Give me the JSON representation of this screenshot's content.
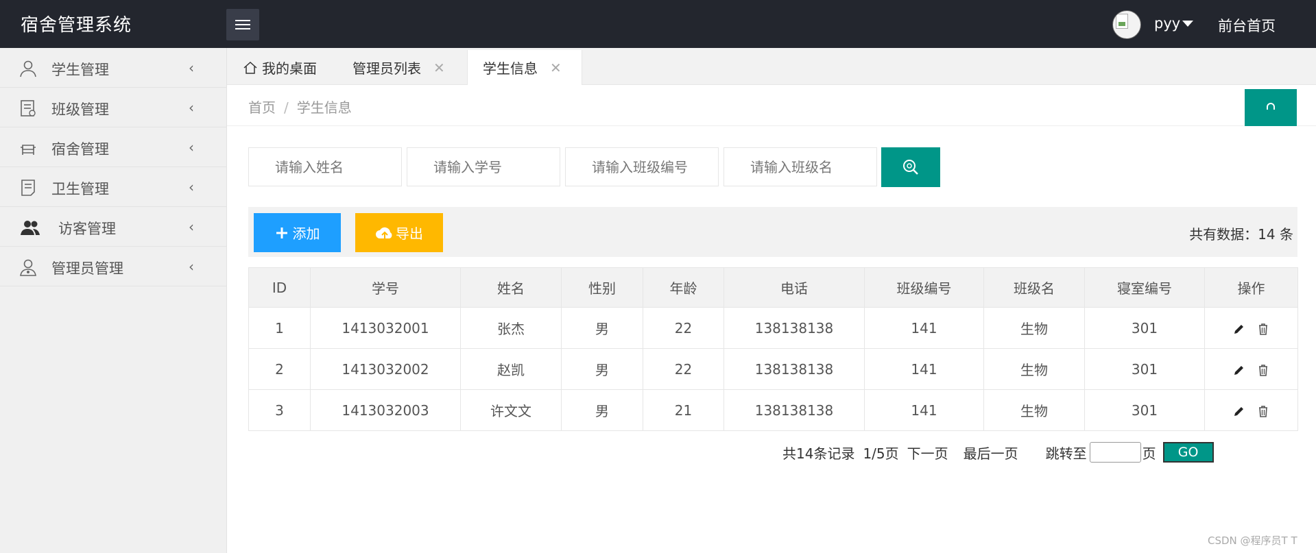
{
  "app": {
    "title": "宿舍管理系统"
  },
  "header": {
    "user": "pyy",
    "front_link": "前台首页"
  },
  "sidebar": {
    "items": [
      {
        "label": "学生管理",
        "icon": "user-icon"
      },
      {
        "label": "班级管理",
        "icon": "class-doc-icon"
      },
      {
        "label": "宿舍管理",
        "icon": "sofa-icon"
      },
      {
        "label": "卫生管理",
        "icon": "note-icon"
      },
      {
        "label": "访客管理",
        "icon": "users-icon"
      },
      {
        "label": "管理员管理",
        "icon": "admin-icon"
      }
    ]
  },
  "tabs": [
    {
      "label": "我的桌面",
      "icon": "home-icon",
      "closable": false
    },
    {
      "label": "管理员列表",
      "closable": true
    },
    {
      "label": "学生信息",
      "closable": true,
      "active": true
    }
  ],
  "breadcrumb": {
    "home": "首页",
    "sep": "/",
    "current": "学生信息"
  },
  "search": {
    "name_placeholder": "请输入姓名",
    "sno_placeholder": "请输入学号",
    "class_no_placeholder": "请输入班级编号",
    "class_name_placeholder": "请输入班级名"
  },
  "toolbar": {
    "add_label": "添加",
    "export_label": "导出",
    "count_text": "共有数据：14 条"
  },
  "table": {
    "headers": [
      "ID",
      "学号",
      "姓名",
      "性别",
      "年龄",
      "电话",
      "班级编号",
      "班级名",
      "寝室编号",
      "操作"
    ],
    "rows": [
      [
        "1",
        "1413032001",
        "张杰",
        "男",
        "22",
        "138138138",
        "141",
        "生物",
        "301"
      ],
      [
        "2",
        "1413032002",
        "赵凯",
        "男",
        "22",
        "138138138",
        "141",
        "生物",
        "301"
      ],
      [
        "3",
        "1413032003",
        "许文文",
        "男",
        "21",
        "138138138",
        "141",
        "生物",
        "301"
      ]
    ]
  },
  "pager": {
    "total": "共14条记录",
    "page": "1/5页",
    "next": "下一页",
    "last": "最后一页",
    "jump": "跳转至",
    "unit": "页",
    "go": "GO"
  },
  "watermark": "CSDN @程序员T T",
  "colors": {
    "header": "#23262e",
    "primary": "#009688",
    "add": "#1e9fff",
    "export": "#ffb800"
  }
}
